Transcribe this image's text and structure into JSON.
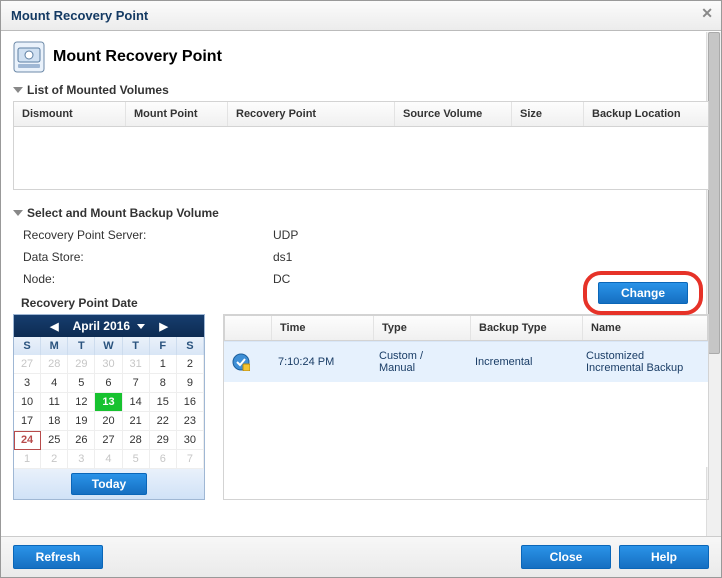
{
  "window": {
    "title": "Mount Recovery Point"
  },
  "page": {
    "heading": "Mount Recovery Point"
  },
  "mounted": {
    "section_title": "List of Mounted Volumes",
    "columns": {
      "dismount": "Dismount",
      "mount_point": "Mount Point",
      "recovery_point": "Recovery Point",
      "source_volume": "Source Volume",
      "size": "Size",
      "backup_location": "Backup Location"
    }
  },
  "select": {
    "section_title": "Select and Mount Backup Volume",
    "server_label": "Recovery Point Server:",
    "server_value": "UDP",
    "datastore_label": "Data Store:",
    "datastore_value": "ds1",
    "node_label": "Node:",
    "node_value": "DC",
    "change_label": "Change"
  },
  "calendar": {
    "title": "Recovery Point Date",
    "month_label": "April 2016",
    "today_label": "Today",
    "dow": [
      "S",
      "M",
      "T",
      "W",
      "T",
      "F",
      "S"
    ],
    "cells": [
      {
        "n": "27",
        "cls": "other"
      },
      {
        "n": "28",
        "cls": "other"
      },
      {
        "n": "29",
        "cls": "other"
      },
      {
        "n": "30",
        "cls": "other"
      },
      {
        "n": "31",
        "cls": "other"
      },
      {
        "n": "1",
        "cls": ""
      },
      {
        "n": "2",
        "cls": ""
      },
      {
        "n": "3",
        "cls": ""
      },
      {
        "n": "4",
        "cls": ""
      },
      {
        "n": "5",
        "cls": ""
      },
      {
        "n": "6",
        "cls": ""
      },
      {
        "n": "7",
        "cls": ""
      },
      {
        "n": "8",
        "cls": ""
      },
      {
        "n": "9",
        "cls": ""
      },
      {
        "n": "10",
        "cls": ""
      },
      {
        "n": "11",
        "cls": ""
      },
      {
        "n": "12",
        "cls": ""
      },
      {
        "n": "13",
        "cls": "rp"
      },
      {
        "n": "14",
        "cls": ""
      },
      {
        "n": "15",
        "cls": ""
      },
      {
        "n": "16",
        "cls": ""
      },
      {
        "n": "17",
        "cls": ""
      },
      {
        "n": "18",
        "cls": ""
      },
      {
        "n": "19",
        "cls": ""
      },
      {
        "n": "20",
        "cls": ""
      },
      {
        "n": "21",
        "cls": ""
      },
      {
        "n": "22",
        "cls": ""
      },
      {
        "n": "23",
        "cls": ""
      },
      {
        "n": "24",
        "cls": "today"
      },
      {
        "n": "25",
        "cls": ""
      },
      {
        "n": "26",
        "cls": ""
      },
      {
        "n": "27",
        "cls": ""
      },
      {
        "n": "28",
        "cls": ""
      },
      {
        "n": "29",
        "cls": ""
      },
      {
        "n": "30",
        "cls": ""
      },
      {
        "n": "1",
        "cls": "other"
      },
      {
        "n": "2",
        "cls": "other"
      },
      {
        "n": "3",
        "cls": "other"
      },
      {
        "n": "4",
        "cls": "other"
      },
      {
        "n": "5",
        "cls": "other"
      },
      {
        "n": "6",
        "cls": "other"
      },
      {
        "n": "7",
        "cls": "other"
      }
    ]
  },
  "rpgrid": {
    "columns": {
      "time": "Time",
      "type": "Type",
      "backup_type": "Backup Type",
      "name": "Name"
    },
    "row": {
      "time": "7:10:24 PM",
      "type": "Custom / Manual",
      "backup_type": "Incremental",
      "name": "Customized Incremental Backup"
    }
  },
  "footer": {
    "refresh": "Refresh",
    "close": "Close",
    "help": "Help"
  }
}
